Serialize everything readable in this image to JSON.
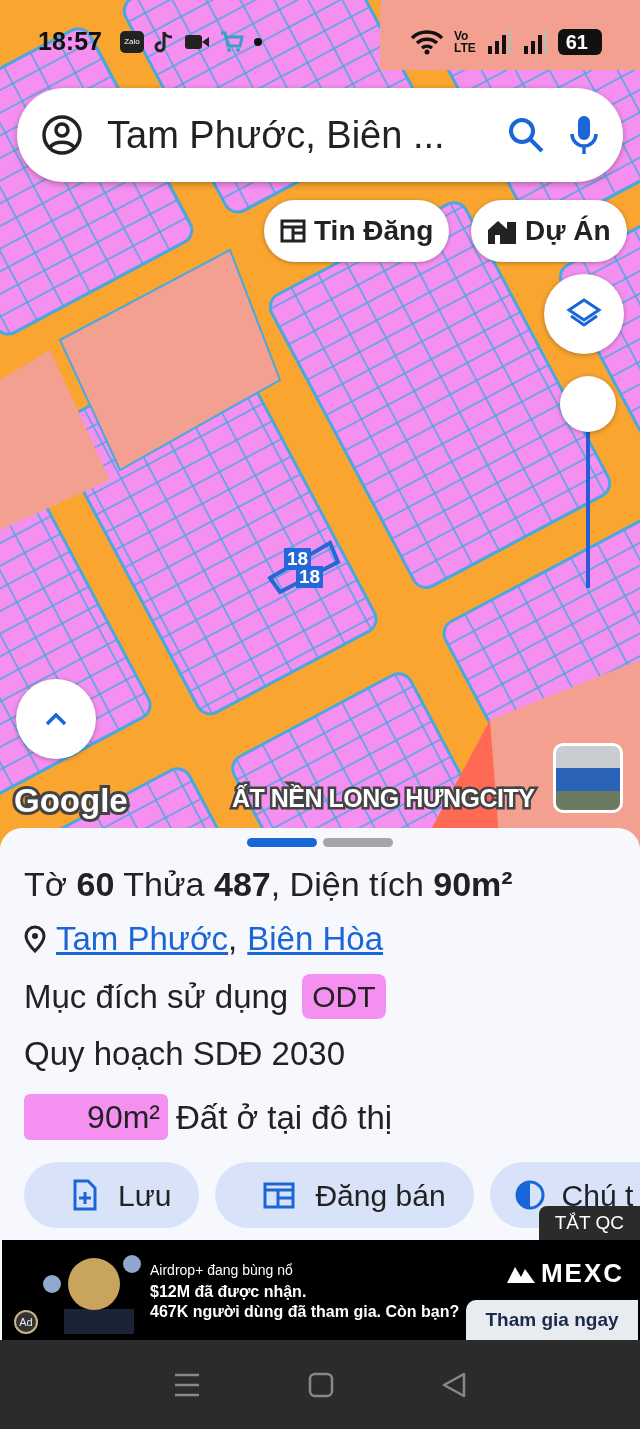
{
  "status_bar": {
    "time": "18:57",
    "app_label": "Zalo",
    "network": {
      "top": "Vo",
      "bottom": "LTE"
    },
    "battery": "61"
  },
  "search": {
    "value": "Tam Phước, Biên ..."
  },
  "chips": [
    {
      "kind": "listing",
      "label": "Tin Đăng"
    },
    {
      "kind": "project",
      "label": "Dự Án"
    }
  ],
  "zoom": {
    "level": 1
  },
  "map": {
    "parcel_labels": [
      "18",
      "18"
    ],
    "attribution": "Google",
    "overlay_label": "ẤT NỀN LONG HƯNGCITY"
  },
  "sheet": {
    "pages": [
      {
        "selected": true
      },
      {
        "selected": false
      }
    ],
    "title": "Tờ **60** Thửa **487**, Diện tích **90m²**",
    "location": {
      "links": [
        "Tam Phước",
        "Biên Hòa"
      ],
      "separator": ","
    },
    "purpose": {
      "label": "Mục đích sử dụng",
      "badge": "ODT",
      "color": "#f590f0"
    },
    "plan": "Quy hoạch SDĐ 2030",
    "legend": [
      {
        "area": "90m²",
        "label": "Đất ở tại đô thị",
        "color": "#f590f0"
      }
    ],
    "actions": [
      {
        "kind": "save",
        "label": "Lưu"
      },
      {
        "kind": "post",
        "label": "Đăng bán"
      },
      {
        "kind": "note",
        "label": "Chú t"
      }
    ]
  },
  "ad": {
    "close": "TẮT QC",
    "badge": "Ad",
    "line1": "Airdrop+ đang bùng nổ",
    "line2": "**$12M** đã được nhận.",
    "line3": "467K người dùng đã tham gia. Còn bạn?",
    "brand": "MEXC",
    "cta": "Tham gia ngay"
  }
}
